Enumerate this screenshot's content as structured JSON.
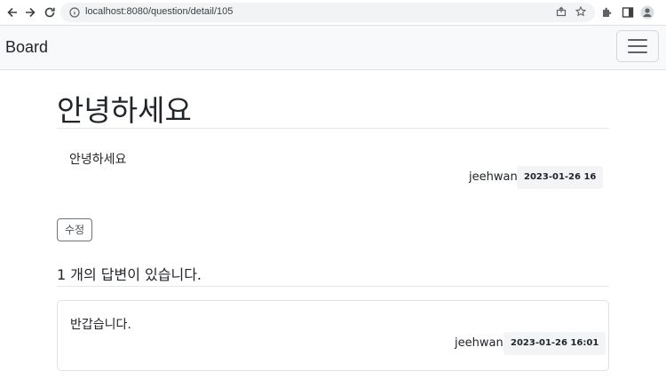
{
  "browser": {
    "url": "localhost:8080/question/detail/105"
  },
  "navbar": {
    "brand": "Board"
  },
  "question": {
    "title": "안녕하세요",
    "body": "안녕하세요",
    "author": "jeehwan",
    "date": "2023-01-26 16",
    "edit_label": "수정"
  },
  "answers": {
    "count_text": "1 개의 답변이 있습니다.",
    "items": [
      {
        "body": "반갑습니다.",
        "author": "jeehwan",
        "date": "2023-01-26 16:01"
      }
    ]
  }
}
